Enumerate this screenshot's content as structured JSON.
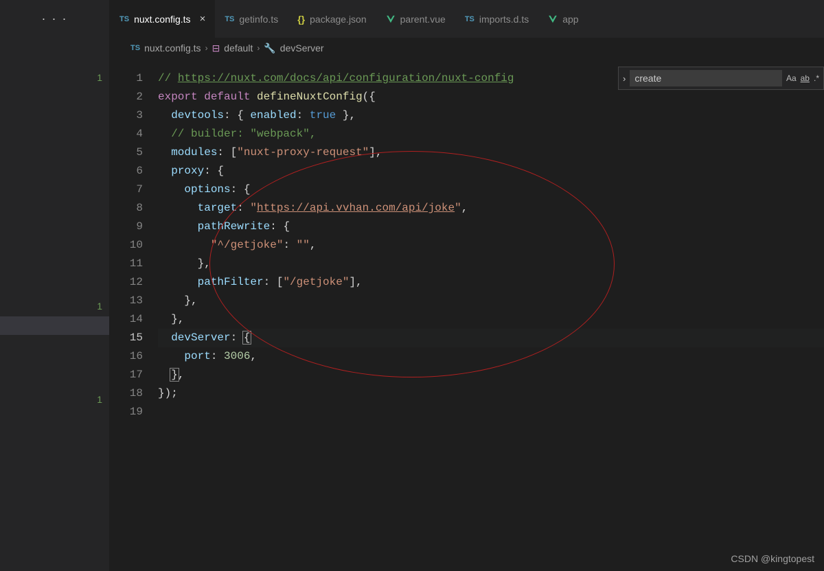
{
  "tabs": [
    {
      "icon": "TS",
      "label": "nuxt.config.ts",
      "active": true,
      "closable": true
    },
    {
      "icon": "TS",
      "label": "getinfo.ts"
    },
    {
      "icon": "{}",
      "label": "package.json",
      "type": "json"
    },
    {
      "icon": "V",
      "label": "parent.vue",
      "type": "vue"
    },
    {
      "icon": "TS",
      "label": "imports.d.ts"
    },
    {
      "icon": "V",
      "label": "app",
      "type": "vue"
    }
  ],
  "breadcrumb": {
    "file": "nuxt.config.ts",
    "sym1": "default",
    "sym2": "devServer"
  },
  "find": {
    "placeholder": "create",
    "aa": "Aa",
    "ab": "ab",
    "re": ".*"
  },
  "markers": {
    "m1": "1",
    "m2": "1",
    "m3": "1"
  },
  "code": {
    "l1_a": "// ",
    "l1_b": "https://nuxt.com/docs/api/configuration/nuxt-config",
    "l2_a": "export",
    "l2_b": "default",
    "l2_c": "defineNuxtConfig",
    "l2_d": "({",
    "l3_a": "devtools",
    "l3_b": ": { ",
    "l3_c": "enabled",
    "l3_d": ": ",
    "l3_e": "true",
    "l3_f": " },",
    "l4": "// builder: \"webpack\",",
    "l5_a": "modules",
    "l5_b": ": [",
    "l5_c": "\"nuxt-proxy-request\"",
    "l5_d": "],",
    "l6_a": "proxy",
    "l6_b": ": {",
    "l7_a": "options",
    "l7_b": ": {",
    "l8_a": "target",
    "l8_b": ": ",
    "l8_c": "\"",
    "l8_d": "https://api.vvhan.com/api/joke",
    "l8_e": "\"",
    "l8_f": ",",
    "l9_a": "pathRewrite",
    "l9_b": ": {",
    "l10_a": "\"^/getjoke\"",
    "l10_b": ": ",
    "l10_c": "\"\"",
    "l10_d": ",",
    "l11": "},",
    "l12_a": "pathFilter",
    "l12_b": ": [",
    "l12_c": "\"/getjoke\"",
    "l12_d": "],",
    "l13": "},",
    "l14": "},",
    "l15_a": "devServer",
    "l15_b": ": ",
    "l15_c": "{",
    "l16_a": "port",
    "l16_b": ": ",
    "l16_c": "3006",
    "l16_d": ",",
    "l17_a": "}",
    "l17_b": ",",
    "l18": "});"
  },
  "watermark": "CSDN @kingtopest",
  "dots": "· · ·"
}
